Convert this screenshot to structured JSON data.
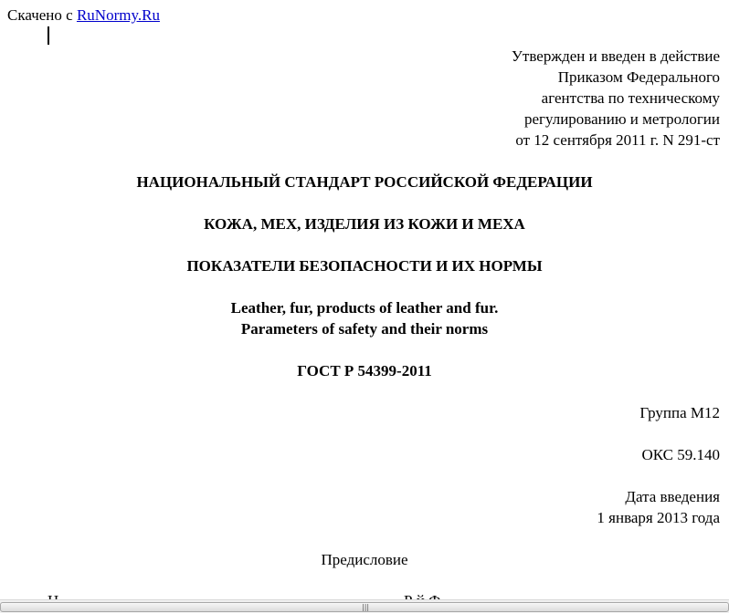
{
  "header": {
    "downloaded_prefix": "Скачено с",
    "site_link": "RuNormy.Ru"
  },
  "approval": {
    "lines": [
      "Утвержден и введен в действие",
      "Приказом Федерального",
      "агентства по техническому",
      "регулированию и метрологии",
      "от 12 сентября 2011 г. N 291-ст"
    ]
  },
  "titles": {
    "standard": "НАЦИОНАЛЬНЫЙ СТАНДАРТ РОССИЙСКОЙ ФЕДЕРАЦИИ",
    "subject": "КОЖА, МЕХ, ИЗДЕЛИЯ ИЗ КОЖИ И МЕХА",
    "indicators": "ПОКАЗАТЕЛИ БЕЗОПАСНОСТИ И ИХ НОРМЫ",
    "english_line1": "Leather, fur, products of leather and fur.",
    "english_line2": "Parameters of safety and their norms",
    "gost": "ГОСТ Р 54399-2011"
  },
  "classification": {
    "group": "Группа М12",
    "oks": "ОКС 59.140",
    "intro_label": "Дата введения",
    "intro_date": "1 января 2013 года"
  },
  "foreword": {
    "heading": "Предисловие"
  }
}
